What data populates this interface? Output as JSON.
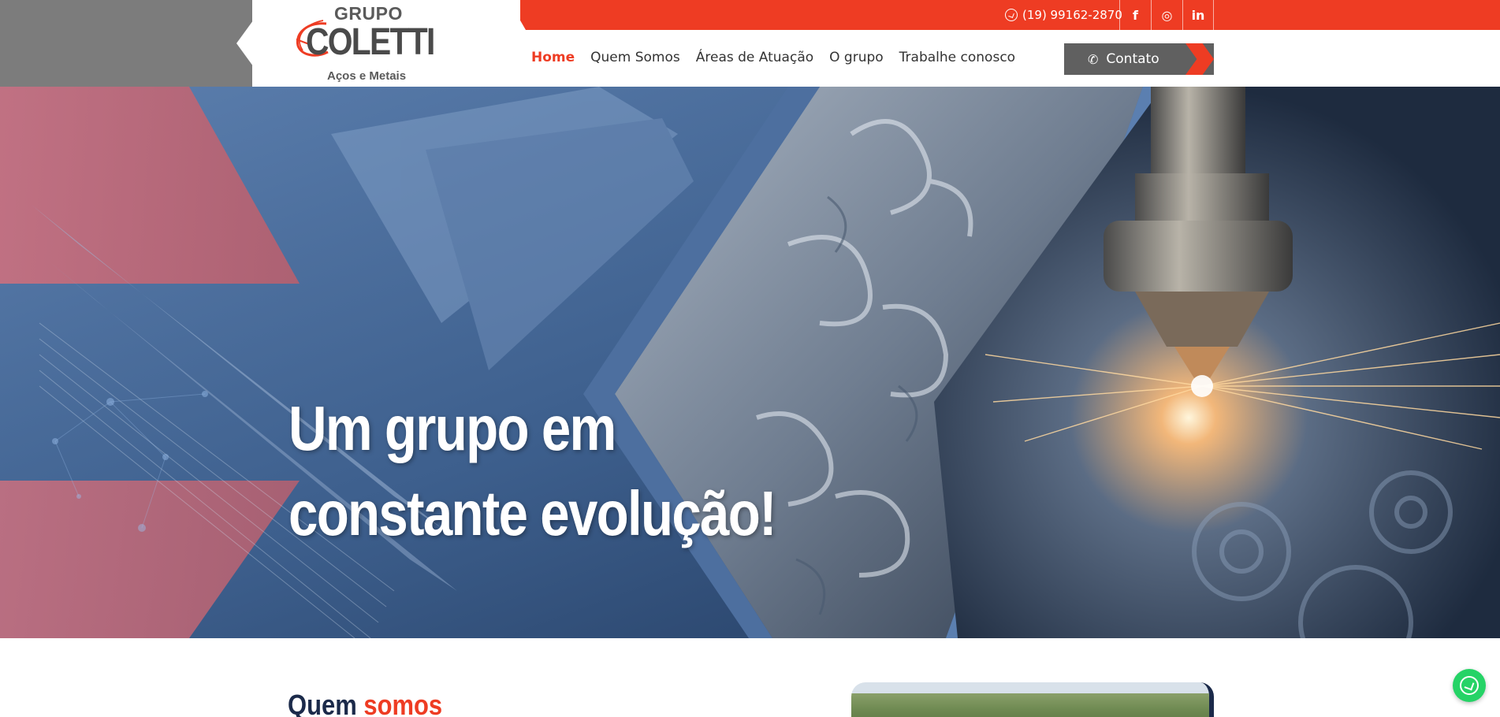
{
  "brand": {
    "logo_top": "GRUPO",
    "logo_main": "COLETTI",
    "logo_sub": "Aços e Metais"
  },
  "topbar": {
    "phone": "(19) 99162-2870",
    "social": [
      {
        "icon": "facebook-icon",
        "glyph": "f"
      },
      {
        "icon": "instagram-icon",
        "glyph": "◎"
      },
      {
        "icon": "linkedin-icon",
        "glyph": "in"
      }
    ]
  },
  "nav": {
    "items": [
      {
        "label": "Home",
        "active": true
      },
      {
        "label": "Quem Somos",
        "active": false
      },
      {
        "label": "Áreas de Atuação",
        "active": false
      },
      {
        "label": "O grupo",
        "active": false
      },
      {
        "label": "Trabalhe conosco",
        "active": false
      }
    ],
    "contact_label": "Contato"
  },
  "hero": {
    "title_line1": "Um grupo em",
    "title_line2": "constante evolução!"
  },
  "section": {
    "heading_main": "Quem",
    "heading_accent": "somos"
  },
  "colors": {
    "accent": "#ee3c23",
    "navy": "#1b2a4a",
    "gray": "#606060"
  }
}
